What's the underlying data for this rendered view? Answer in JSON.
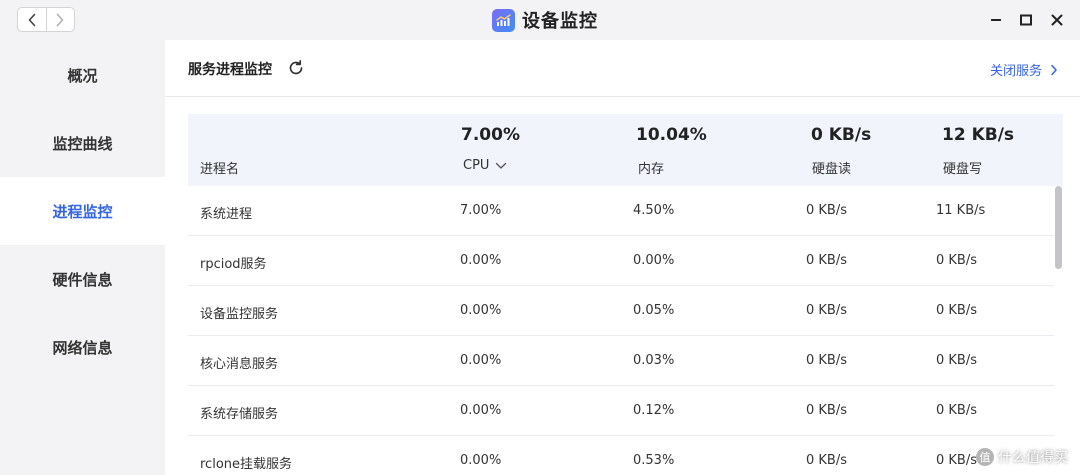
{
  "window": {
    "title": "设备监控",
    "icons": {
      "back": "chevron-left-icon",
      "forward": "chevron-right-icon",
      "app": "chart-app-icon",
      "minimize": "minimize-icon",
      "maximize": "maximize-icon",
      "close": "close-icon"
    }
  },
  "sidebar": {
    "items": [
      {
        "label": "概况"
      },
      {
        "label": "监控曲线"
      },
      {
        "label": "进程监控",
        "active": true
      },
      {
        "label": "硬件信息"
      },
      {
        "label": "网络信息"
      }
    ]
  },
  "main": {
    "section_title": "服务进程监控",
    "refresh_icon": "refresh-icon",
    "close_service_label": "关闭服务"
  },
  "table": {
    "name_header": "进程名",
    "columns": [
      {
        "key": "cpu",
        "total": "7.00%",
        "label": "CPU",
        "sorted": true
      },
      {
        "key": "mem",
        "total": "10.04%",
        "label": "内存"
      },
      {
        "key": "disk_read",
        "total": "0 KB/s",
        "label": "硬盘读"
      },
      {
        "key": "disk_write",
        "total": "12 KB/s",
        "label": "硬盘写"
      }
    ],
    "rows": [
      [
        "系统进程",
        "7.00%",
        "4.50%",
        "0 KB/s",
        "11 KB/s"
      ],
      [
        "rpciod服务",
        "0.00%",
        "0.00%",
        "0 KB/s",
        "0 KB/s"
      ],
      [
        "设备监控服务",
        "0.00%",
        "0.05%",
        "0 KB/s",
        "0 KB/s"
      ],
      [
        "核心消息服务",
        "0.00%",
        "0.03%",
        "0 KB/s",
        "0 KB/s"
      ],
      [
        "系统存储服务",
        "0.00%",
        "0.12%",
        "0 KB/s",
        "0 KB/s"
      ],
      [
        "rclone挂载服务",
        "0.00%",
        "0.53%",
        "0 KB/s",
        "0 KB/s"
      ]
    ]
  },
  "watermark": {
    "badge": "值",
    "text": "什么值得买"
  },
  "colors": {
    "accent": "#3565e2",
    "sidebar_bg": "#f3f3f5",
    "table_header_bg": "#f1f4fb"
  }
}
